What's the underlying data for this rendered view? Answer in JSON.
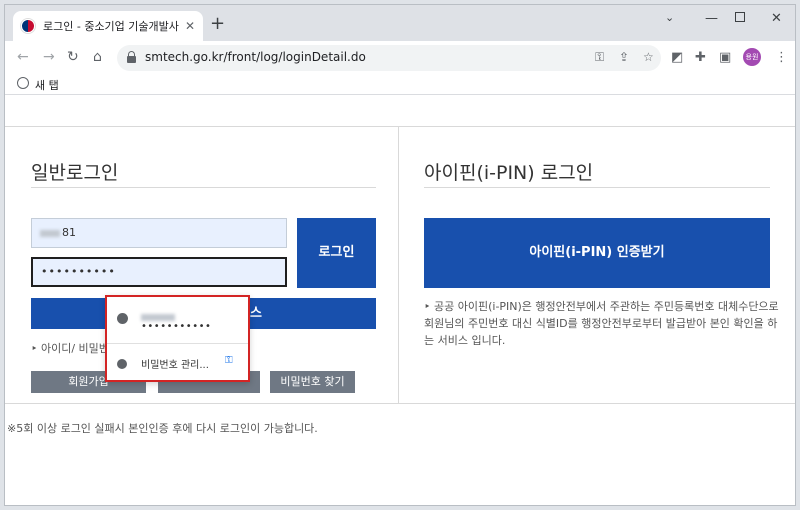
{
  "browser": {
    "tab_title": "로그인 - 중소기업 기술개발사인",
    "tab_close": "✕",
    "new_tab": "+",
    "url": "smtech.go.kr/front/log/loginDetail.do",
    "profile_initials": "용원",
    "bookmark_label": "새 탭",
    "icons": [
      "back-icon",
      "forward-icon",
      "reload-icon",
      "home-icon",
      "lock-icon",
      "key-icon",
      "share-icon",
      "star-icon",
      "extension-icon",
      "puzzle-icon",
      "sidepanel-icon",
      "menu-icon"
    ]
  },
  "login": {
    "title": "일반로그인",
    "id_value_suffix": "81",
    "password_value": "••••••••••",
    "login_button": "로그인",
    "cert_button_suffix": "스",
    "find_text": "아이디/ 비밀번",
    "signup_button": "회원가입",
    "find_password_button": "비밀번호 찾기"
  },
  "ipin": {
    "title": "아이핀(i-PIN) 로그인",
    "button": "아이핀(i-PIN) 인증받기",
    "description": "공공 아이핀(i-PIN)은 행정안전부에서 주관하는 주민등록번호 대체수단으로 회원님의 주민번호 대신 식별ID를 행정안전부로부터 발급받아 본인 확인을 하는 서비스 입니다."
  },
  "notice": "※5회 이상 로그인 실패시 본인인증 후에 다시 로그인이 가능합니다.",
  "password_popup": {
    "saved_password": "•••••••••••",
    "manage_label": "비밀번호 관리...",
    "key_glyph": "⚿"
  },
  "colors": {
    "primary_blue": "#1850ad",
    "gray_button": "#6f7884",
    "popup_highlight": "#d32424"
  }
}
